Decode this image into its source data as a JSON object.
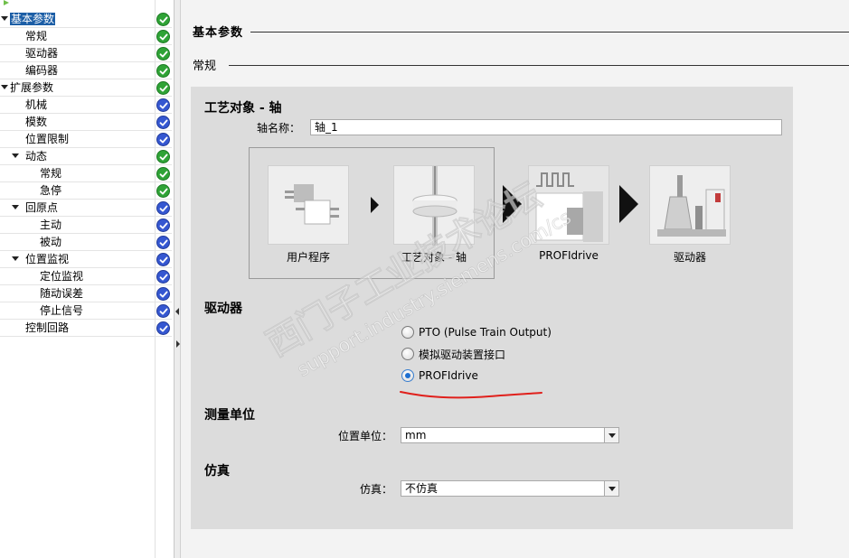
{
  "nav": {
    "items": [
      {
        "label": "基本参数",
        "level": 0,
        "expander": true,
        "selected": true,
        "status": "ok"
      },
      {
        "label": "常规",
        "level": 1,
        "expander": false,
        "selected": false,
        "status": "ok"
      },
      {
        "label": "驱动器",
        "level": 1,
        "expander": false,
        "selected": false,
        "status": "ok"
      },
      {
        "label": "编码器",
        "level": 1,
        "expander": false,
        "selected": false,
        "status": "ok"
      },
      {
        "label": "扩展参数",
        "level": 0,
        "expander": true,
        "selected": false,
        "status": "ok"
      },
      {
        "label": "机械",
        "level": 1,
        "expander": false,
        "selected": false,
        "status": "warn"
      },
      {
        "label": "模数",
        "level": 1,
        "expander": false,
        "selected": false,
        "status": "warn"
      },
      {
        "label": "位置限制",
        "level": 1,
        "expander": false,
        "selected": false,
        "status": "warn"
      },
      {
        "label": "动态",
        "level": 1,
        "expander": true,
        "selected": false,
        "status": "ok"
      },
      {
        "label": "常规",
        "level": 2,
        "expander": false,
        "selected": false,
        "status": "ok"
      },
      {
        "label": "急停",
        "level": 2,
        "expander": false,
        "selected": false,
        "status": "ok"
      },
      {
        "label": "回原点",
        "level": 1,
        "expander": true,
        "selected": false,
        "status": "warn"
      },
      {
        "label": "主动",
        "level": 2,
        "expander": false,
        "selected": false,
        "status": "warn"
      },
      {
        "label": "被动",
        "level": 2,
        "expander": false,
        "selected": false,
        "status": "warn"
      },
      {
        "label": "位置监视",
        "level": 1,
        "expander": true,
        "selected": false,
        "status": "warn"
      },
      {
        "label": "定位监视",
        "level": 2,
        "expander": false,
        "selected": false,
        "status": "warn"
      },
      {
        "label": "随动误差",
        "level": 2,
        "expander": false,
        "selected": false,
        "status": "warn"
      },
      {
        "label": "停止信号",
        "level": 2,
        "expander": false,
        "selected": false,
        "status": "warn"
      },
      {
        "label": "控制回路",
        "level": 1,
        "expander": false,
        "selected": false,
        "status": "warn"
      }
    ],
    "status_colors": {
      "ok": "#2fa336",
      "warn": "#3557d1"
    }
  },
  "main": {
    "heading": "基本参数",
    "subheading": "常规",
    "tech_object": {
      "title": "工艺对象 - 轴",
      "axis_name_label": "轴名称：",
      "axis_name_value": "轴_1"
    },
    "diagram": {
      "captions": [
        "用户程序",
        "工艺对象 - 轴",
        "PROFIdrive",
        "驱动器"
      ]
    },
    "drive": {
      "title": "驱动器",
      "options": [
        {
          "label": "PTO (Pulse Train Output)",
          "checked": false
        },
        {
          "label": "模拟驱动装置接口",
          "checked": false
        },
        {
          "label": "PROFIdrive",
          "checked": true
        }
      ]
    },
    "measure": {
      "title": "测量单位",
      "label": "位置单位：",
      "value": "mm"
    },
    "simulation": {
      "title": "仿真",
      "label": "仿真：",
      "value": "不仿真"
    }
  },
  "watermark": {
    "line1": "西门子工业技术论坛",
    "line2": "support.industry.siemens.com/cs"
  },
  "annotation_color": "#e0201c"
}
